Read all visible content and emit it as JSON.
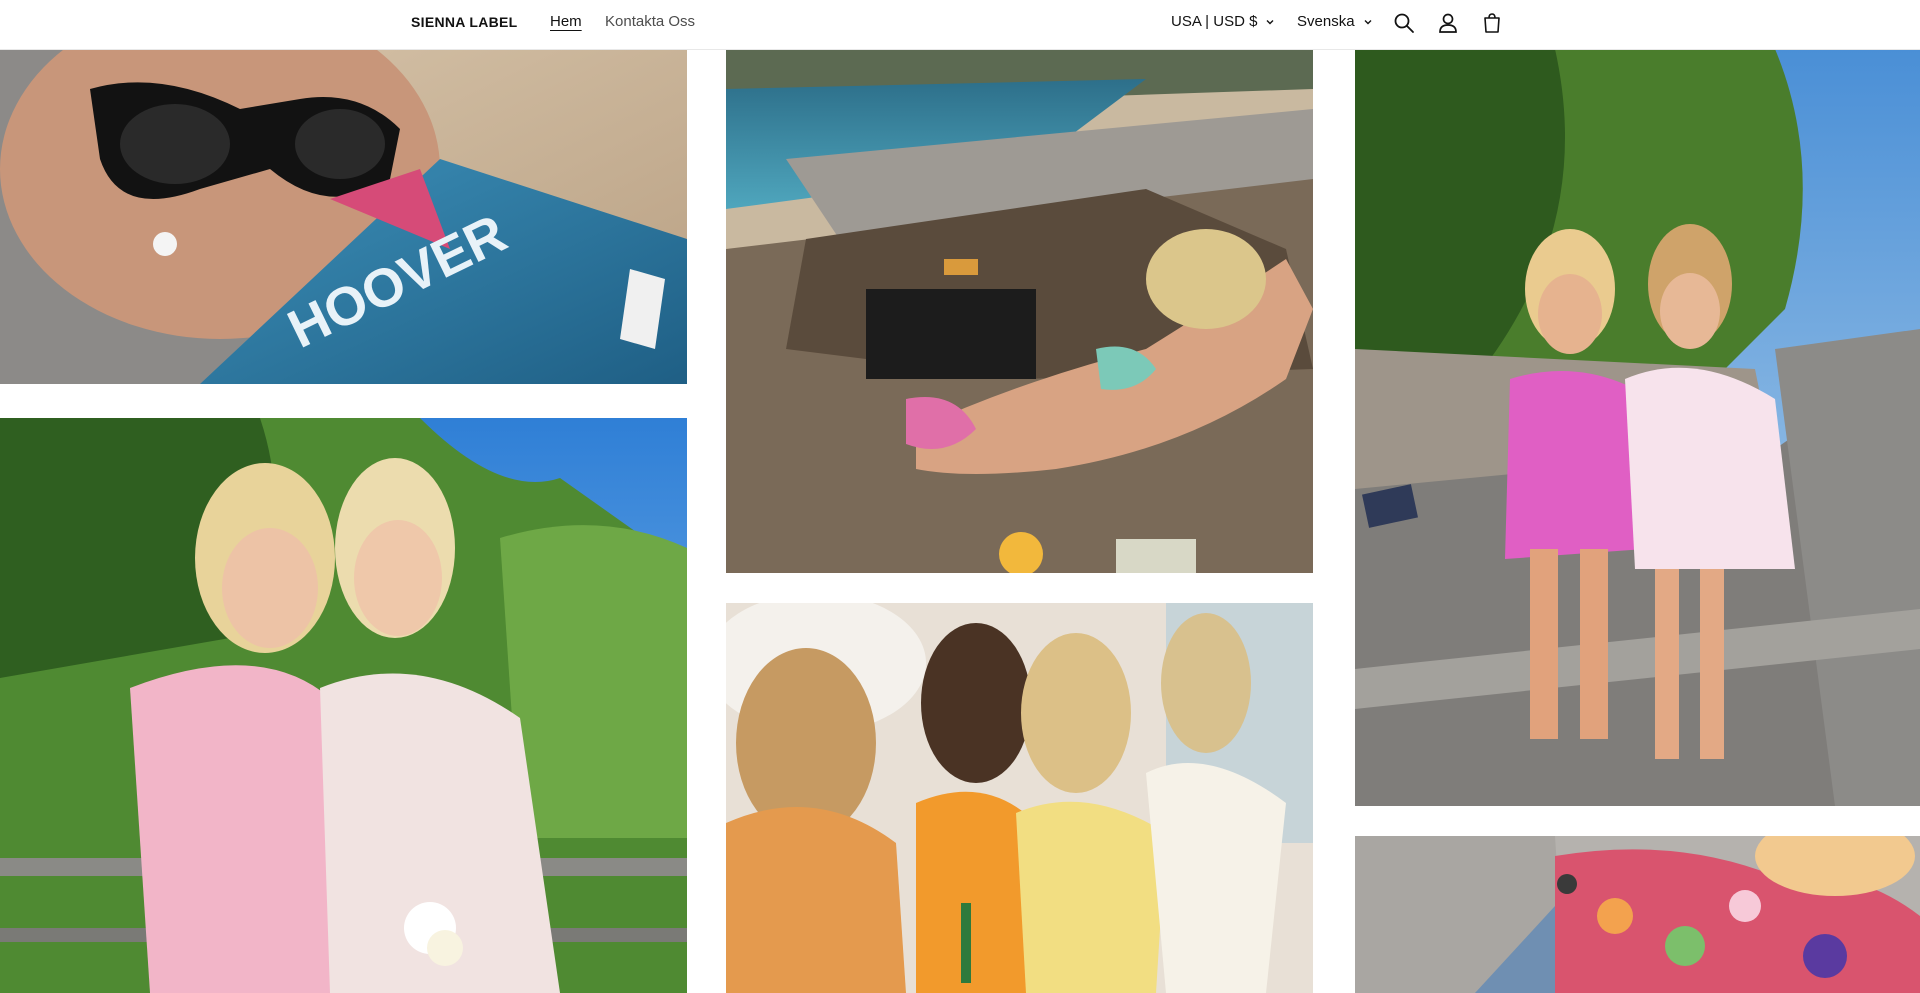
{
  "header": {
    "logo": "SIENNA LABEL",
    "nav": [
      {
        "label": "Hem",
        "active": true
      },
      {
        "label": "Kontakta Oss",
        "active": false
      }
    ],
    "country_selector": "USA | USD $",
    "language_selector": "Svenska",
    "icons": [
      "search-icon",
      "account-icon",
      "cart-icon"
    ]
  },
  "gallery": {
    "photos": [
      {
        "name": "photo-book-sunglasses",
        "alt": ""
      },
      {
        "name": "photo-friends-garden",
        "alt": ""
      },
      {
        "name": "photo-beach-lounger",
        "alt": ""
      },
      {
        "name": "photo-group-party",
        "alt": ""
      },
      {
        "name": "photo-street-friends",
        "alt": ""
      },
      {
        "name": "photo-floral-top",
        "alt": ""
      }
    ]
  },
  "colors": {
    "text": "#121212",
    "muted": "#4d4d4d",
    "background": "#ffffff"
  }
}
